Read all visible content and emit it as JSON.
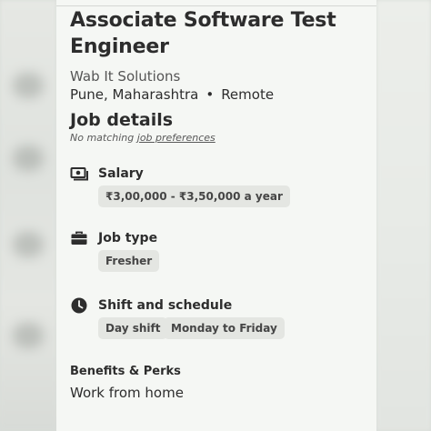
{
  "job": {
    "title": "Associate Software Test Engineer",
    "company": "Wab It Solutions",
    "location": "Pune, Maharashtra",
    "separator": "•",
    "work_mode": "Remote"
  },
  "details": {
    "heading": "Job details",
    "note_prefix": "No matching ",
    "note_link": "job preferences",
    "salary": {
      "label": "Salary",
      "icon": "money-icon",
      "chips": [
        "₹3,00,000 - ₹3,50,000 a year"
      ]
    },
    "job_type": {
      "label": "Job type",
      "icon": "briefcase-icon",
      "chips": [
        "Fresher"
      ]
    },
    "schedule": {
      "label": "Shift and schedule",
      "icon": "clock-icon",
      "chips": [
        "Day shift",
        "Monday to Friday"
      ]
    }
  },
  "benefits": {
    "heading": "Benefits & Perks",
    "items": [
      "Work from home"
    ]
  },
  "colors": {
    "text": "#2d2d2d",
    "muted": "#595959",
    "chip_bg": "#e4e6e2",
    "card_bg": "#f5f7f4"
  }
}
